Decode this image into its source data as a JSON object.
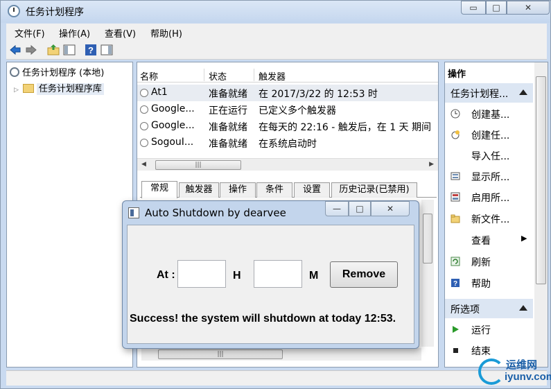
{
  "window": {
    "title": "任务计划程序",
    "min_glyph": "▭",
    "max_glyph": "□",
    "close_glyph": "✕"
  },
  "menu": [
    "文件(F)",
    "操作(A)",
    "查看(V)",
    "帮助(H)"
  ],
  "toolbar": {
    "help_glyph": "?"
  },
  "tree": {
    "root_label": "任务计划程序 (本地)",
    "child_label": "任务计划程序库",
    "expand_glyph": "▷"
  },
  "list": {
    "columns": [
      "名称",
      "状态",
      "触发器"
    ],
    "rows": [
      {
        "name": "At1",
        "status": "准备就绪",
        "trigger": "在 2017/3/22 的 12:53 时"
      },
      {
        "name": "Google...",
        "status": "正在运行",
        "trigger": "已定义多个触发器"
      },
      {
        "name": "Google...",
        "status": "准备就绪",
        "trigger": "在每天的 22:16 - 触发后，在 1 天 期间"
      },
      {
        "name": "SogouI...",
        "status": "准备就绪",
        "trigger": "在系统启动时"
      }
    ],
    "scroll_grip": "|||"
  },
  "detail_tabs": [
    "常规",
    "触发器",
    "操作",
    "条件",
    "设置",
    "历史记录(已禁用)"
  ],
  "actions": {
    "title": "操作",
    "section1": "任务计划程...",
    "items1": [
      "创建基...",
      "创建任...",
      "导入任...",
      "显示所...",
      "启用所...",
      "新文件...",
      "查看",
      "刷新",
      "帮助"
    ],
    "section2": "所选项",
    "items2": [
      "运行",
      "结束"
    ],
    "submenu_glyph": "▶"
  },
  "dialog": {
    "title": "Auto Shutdown by dearvee",
    "at_label": "At :",
    "h_label": "H",
    "m_label": "M",
    "hour_value": "",
    "minute_value": "",
    "remove_label": "Remove",
    "message": "Success! the system will shutdown at today 12:53.",
    "min_glyph": "—",
    "max_glyph": "□",
    "close_glyph": "✕"
  },
  "watermark": {
    "line1": "运维网",
    "line2": "iyunv.com"
  }
}
